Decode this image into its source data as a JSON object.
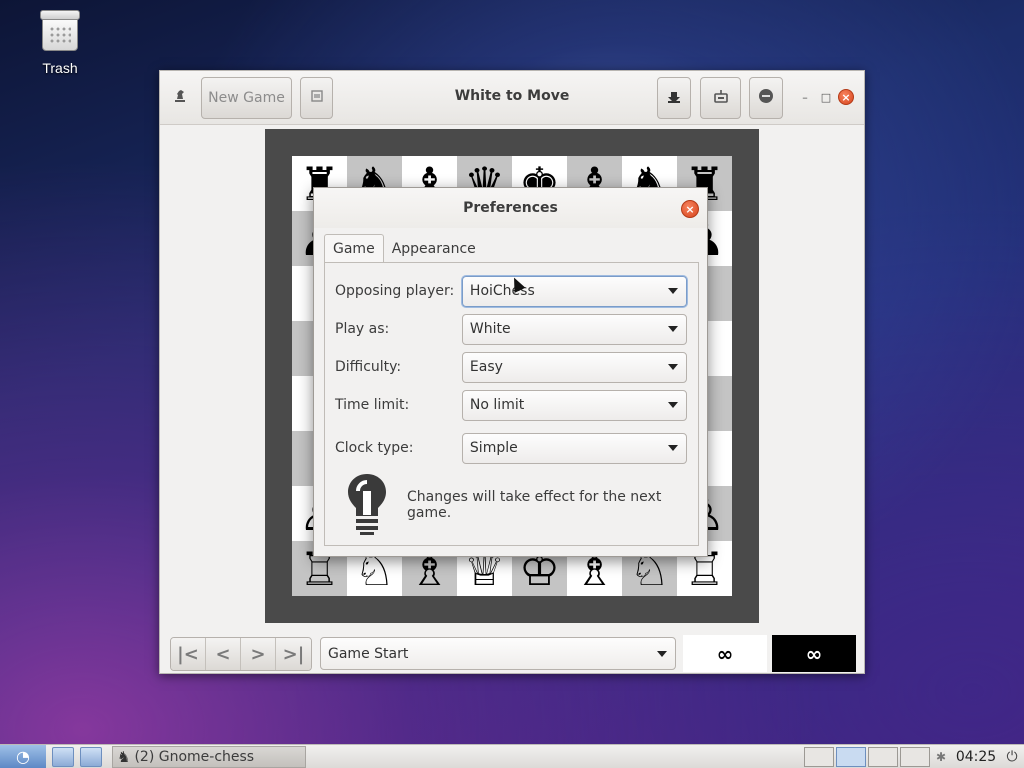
{
  "desktop": {
    "trash_label": "Trash"
  },
  "window": {
    "title": "White to Move",
    "new_game_label": "New Game"
  },
  "board": {
    "rows": [
      [
        "♜",
        "♞",
        "♝",
        "♛",
        "♚",
        "♝",
        "♞",
        "♜"
      ],
      [
        "♟",
        "",
        "",
        "",
        "",
        "",
        "",
        "♟"
      ],
      [
        "",
        "",
        "",
        "",
        "",
        "",
        "",
        ""
      ],
      [
        "",
        "",
        "",
        "",
        "",
        "",
        "",
        ""
      ],
      [
        "",
        "",
        "",
        "",
        "",
        "",
        "",
        ""
      ],
      [
        "",
        "",
        "",
        "",
        "",
        "",
        "",
        ""
      ],
      [
        "♙",
        "",
        "",
        "",
        "",
        "",
        "",
        "♙"
      ],
      [
        "♖",
        "♘",
        "♗",
        "♕",
        "♔",
        "♗",
        "♘",
        "♖"
      ]
    ]
  },
  "bottombar": {
    "history_value": "Game Start",
    "clock_white": "∞",
    "clock_black": "∞"
  },
  "dialog": {
    "title": "Preferences",
    "tabs": [
      "Game",
      "Appearance"
    ],
    "fields": [
      {
        "label": "Opposing player:",
        "value": "HoiChess"
      },
      {
        "label": "Play as:",
        "value": "White"
      },
      {
        "label": "Difficulty:",
        "value": "Easy"
      },
      {
        "label": "Time limit:",
        "value": "No limit"
      },
      {
        "label": "Clock type:",
        "value": "Simple"
      }
    ],
    "hint": "Changes will take effect for the next game."
  },
  "taskbar": {
    "task_label": "(2) Gnome-chess",
    "clock": "04:25"
  }
}
